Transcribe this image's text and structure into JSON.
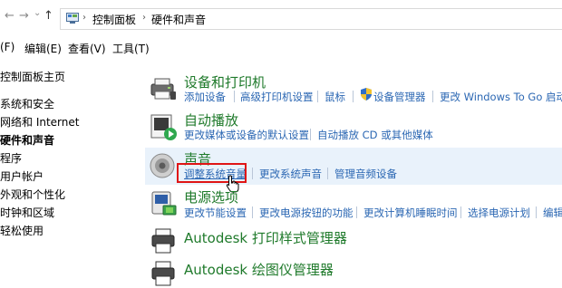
{
  "nav": {
    "back": "←",
    "forward": "→",
    "dropdown": "⌄",
    "up": "↑"
  },
  "breadcrumb": [
    "控制面板",
    "硬件和声音"
  ],
  "menubar": [
    "(F)",
    "编辑(E)",
    "查看(V)",
    "工具(T)"
  ],
  "sidebar": {
    "home": "控制面板主页",
    "items": [
      "系统和安全",
      "网络和 Internet",
      "硬件和声音",
      "程序",
      "用户帐户",
      "外观和个性化",
      "时钟和区域",
      "轻松使用"
    ],
    "active_index": 2
  },
  "categories": {
    "devices": {
      "title": "设备和打印机",
      "links": [
        "添加设备",
        "高级打印机设置",
        "鼠标",
        "设备管理器",
        "更改 Windows To Go 启动选"
      ]
    },
    "autoplay": {
      "title": "自动播放",
      "links": [
        "更改媒体或设备的默认设置",
        "自动播放 CD 或其他媒体"
      ]
    },
    "sound": {
      "title": "声音",
      "links": [
        "调整系统音量",
        "更改系统声音",
        "管理音频设备"
      ]
    },
    "power": {
      "title": "电源选项",
      "links": [
        "更改节能设置",
        "更改电源按钮的功能",
        "更改计算机睡眠时间",
        "选择电源计划",
        "编辑"
      ]
    },
    "autodesk_print": {
      "title": "Autodesk 打印样式管理器"
    },
    "autodesk_plotter": {
      "title": "Autodesk 绘图仪管理器"
    }
  },
  "colors": {
    "link": "#2b67b3",
    "category_title": "#1f7a2b",
    "highlight_box": "#e01515",
    "hover_row": "#e9f2fb"
  }
}
